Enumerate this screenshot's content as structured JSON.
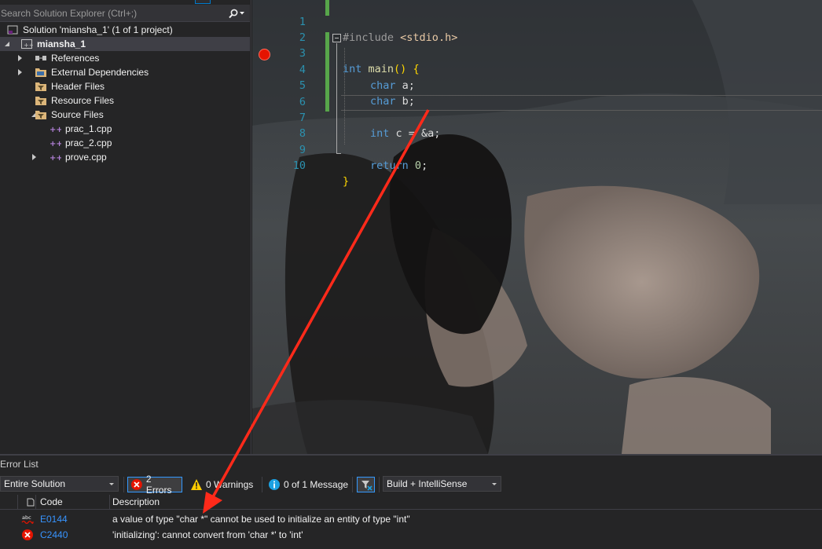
{
  "solution_explorer": {
    "search_placeholder": "Search Solution Explorer (Ctrl+;)",
    "tree": [
      {
        "label": "Solution 'miansha_1' (1 of 1 project)",
        "icon": "solution-icon"
      },
      {
        "label": "miansha_1",
        "icon": "cpp-project-icon"
      },
      {
        "label": "References",
        "icon": "references-icon"
      },
      {
        "label": "External Dependencies",
        "icon": "folder-icon"
      },
      {
        "label": "Header Files",
        "icon": "filter-folder-icon"
      },
      {
        "label": "Resource Files",
        "icon": "filter-folder-icon"
      },
      {
        "label": "Source Files",
        "icon": "filter-folder-icon"
      },
      {
        "label": "prac_1.cpp",
        "icon": "cpp-file-icon"
      },
      {
        "label": "prac_2.cpp",
        "icon": "cpp-file-icon"
      },
      {
        "label": "prove.cpp",
        "icon": "cpp-file-icon"
      }
    ]
  },
  "editor": {
    "line_numbers": [
      "1",
      "2",
      "3",
      "4",
      "5",
      "6",
      "7",
      "8",
      "9",
      "10"
    ],
    "code": {
      "l1_directive": "#include",
      "l1_header": "<stdio.h>",
      "l3_type": "int",
      "l3_name": "main",
      "l3_parens": "()",
      "l3_brace": "{",
      "l4_type": "char",
      "l4_rest": "a;",
      "l5_type": "char",
      "l5_rest": "b;",
      "l7_type": "int",
      "l7_rest": "c = &a;",
      "l9_keyword": "return",
      "l9_value": "0",
      "l9_semi": ";",
      "l10_brace": "}"
    },
    "breakpoint_line": 4,
    "current_line": 7
  },
  "error_list": {
    "title": "Error List",
    "scope_value": "Entire Solution",
    "errors_label": "2 Errors",
    "warnings_label": "0 Warnings",
    "messages_label": "0 of 1 Message",
    "source_value": "Build + IntelliSense",
    "columns": {
      "code": "Code",
      "description": "Description"
    },
    "rows": [
      {
        "icon": "intellisense-error-icon",
        "code": "E0144",
        "description": "a value of type \"char *\" cannot be used to initialize an entity of type \"int\""
      },
      {
        "icon": "build-error-icon",
        "code": "C2440",
        "description": "'initializing': cannot convert from 'char *' to 'int'"
      }
    ]
  },
  "annotation": {
    "color": "#ff2a1a"
  }
}
